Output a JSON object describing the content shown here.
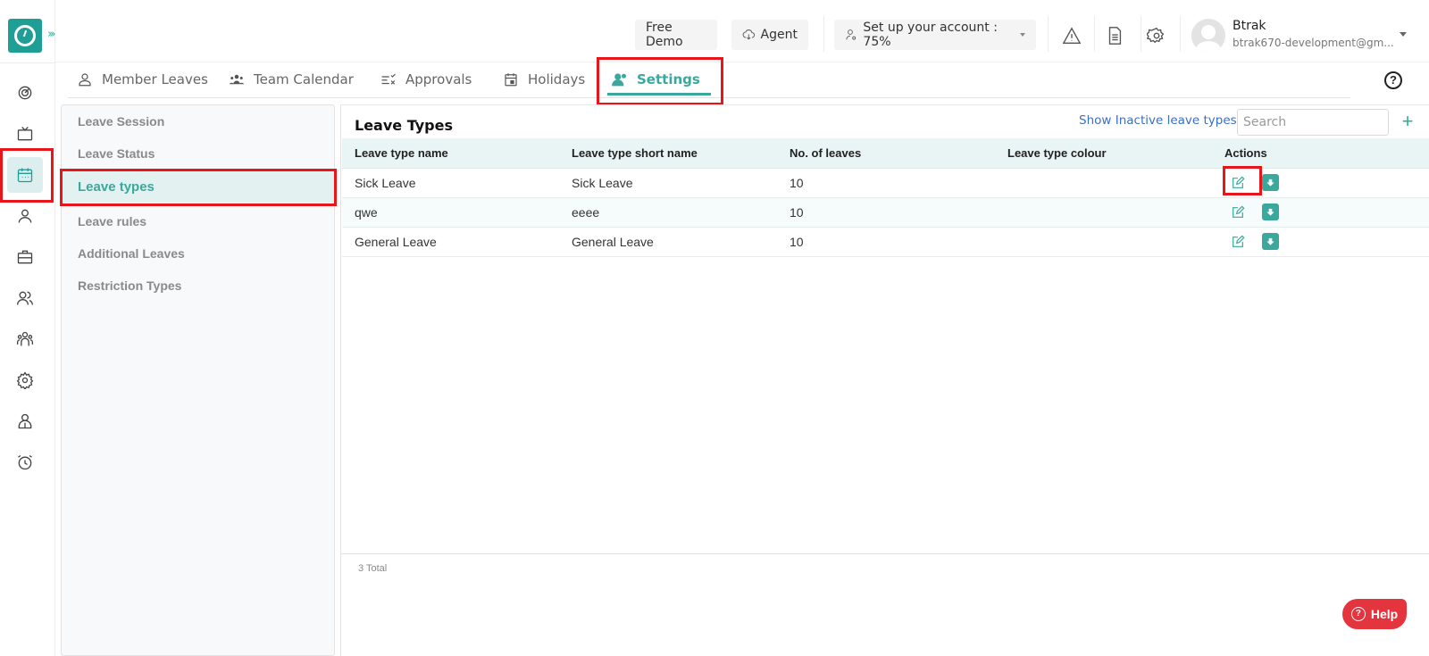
{
  "header": {
    "free_demo": "Free Demo",
    "agent": "Agent",
    "setup_account": "Set up your account : 75%",
    "setup_progress_percent": 75,
    "user_name": "Btrak",
    "user_email": "btrak670-development@gm..."
  },
  "rail": {
    "items": [
      {
        "icon": "dashboard-icon"
      },
      {
        "icon": "tv-icon"
      },
      {
        "icon": "calendar-icon",
        "active": true
      },
      {
        "icon": "user-icon"
      },
      {
        "icon": "briefcase-icon"
      },
      {
        "icon": "users-icon"
      },
      {
        "icon": "team-icon"
      },
      {
        "icon": "gear-icon"
      },
      {
        "icon": "profile-icon"
      },
      {
        "icon": "alarm-clock-icon"
      }
    ]
  },
  "tabs": [
    {
      "label": "Member Leaves",
      "icon": "user-icon"
    },
    {
      "label": "Team Calendar",
      "icon": "team-icon"
    },
    {
      "label": "Approvals",
      "icon": "approvals-icon"
    },
    {
      "label": "Holidays",
      "icon": "calendar-icon"
    },
    {
      "label": "Settings",
      "icon": "settings-users-icon",
      "active": true
    }
  ],
  "settings_nav": [
    {
      "label": "Leave Session"
    },
    {
      "label": "Leave Status"
    },
    {
      "label": "Leave types",
      "active": true
    },
    {
      "label": "Leave rules"
    },
    {
      "label": "Additional Leaves"
    },
    {
      "label": "Restriction Types"
    }
  ],
  "main": {
    "title": "Leave Types",
    "show_inactive_link": "Show Inactive leave types",
    "search_placeholder": "Search",
    "add_label": "+",
    "columns": [
      "Leave type name",
      "Leave type short name",
      "No. of leaves",
      "Leave type colour",
      "Actions"
    ],
    "rows": [
      {
        "name": "Sick Leave",
        "short_name": "Sick Leave",
        "leaves": "10",
        "colour": ""
      },
      {
        "name": "qwe",
        "short_name": "eeee",
        "leaves": "10",
        "colour": ""
      },
      {
        "name": "General Leave",
        "short_name": "General Leave",
        "leaves": "10",
        "colour": ""
      }
    ],
    "total": "3 Total"
  },
  "help_button": "Help",
  "colors": {
    "accent": "#3aa89c",
    "logo": "#1f9e96",
    "highlight": "#e8161b",
    "help": "#e4343e",
    "link": "#3d6fc1"
  }
}
